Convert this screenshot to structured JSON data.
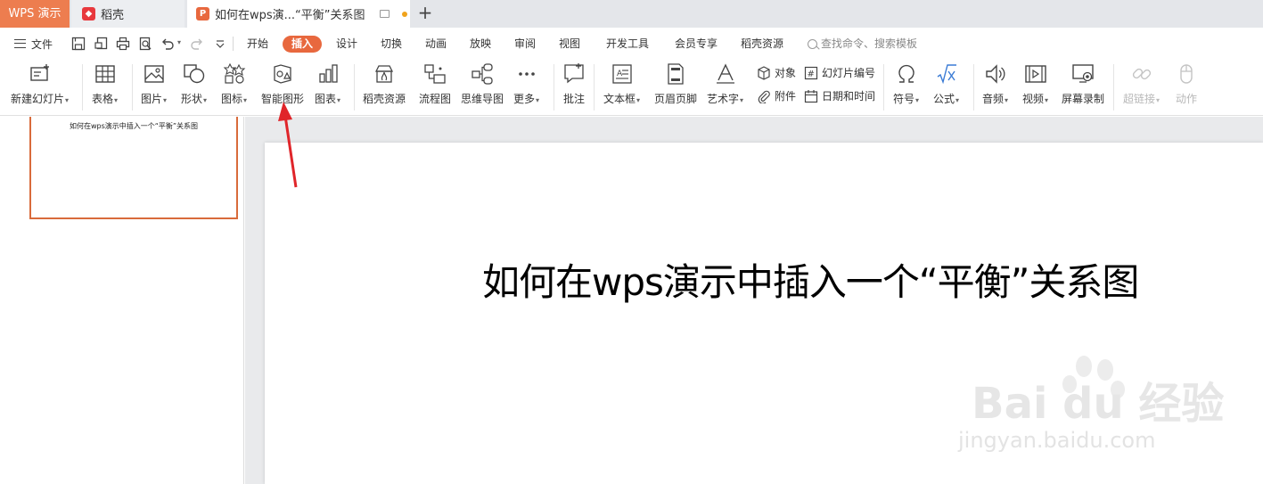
{
  "tabs": {
    "app": "WPS 演示",
    "doker": "稻壳",
    "document": "如何在wps演...“平衡”关系图",
    "add": "+"
  },
  "menu": {
    "file": "文件",
    "items": [
      "开始",
      "插入",
      "设计",
      "切换",
      "动画",
      "放映",
      "审阅",
      "视图",
      "开发工具",
      "会员专享",
      "稻壳资源"
    ],
    "active": "插入",
    "search": "查找命令、搜索模板"
  },
  "ribbon": {
    "new_slide": "新建幻灯片",
    "table": "表格",
    "picture": "图片",
    "shape": "形状",
    "icon": "图标",
    "smartart": "智能图形",
    "chart": "图表",
    "doker_res": "稻壳资源",
    "flowchart": "流程图",
    "mindmap": "思维导图",
    "more": "更多",
    "comment": "批注",
    "textbox": "文本框",
    "header_footer": "页眉页脚",
    "wordart": "艺术字",
    "object": "对象",
    "attachment": "附件",
    "slide_number": "幻灯片编号",
    "date_time": "日期和时间",
    "symbol": "符号",
    "formula": "公式",
    "audio": "音频",
    "video": "视频",
    "screen_record": "屏幕录制",
    "hyperlink": "超链接",
    "action": "动作"
  },
  "slide": {
    "title": "如何在wps演示中插入一个“平衡”关系图"
  },
  "watermark": {
    "brand": "Bai du 经验",
    "url": "jingyan.baidu.com"
  },
  "colors": {
    "accent": "#e8683e",
    "app_tab": "#ed7d4f",
    "arrow": "#e0252a"
  }
}
